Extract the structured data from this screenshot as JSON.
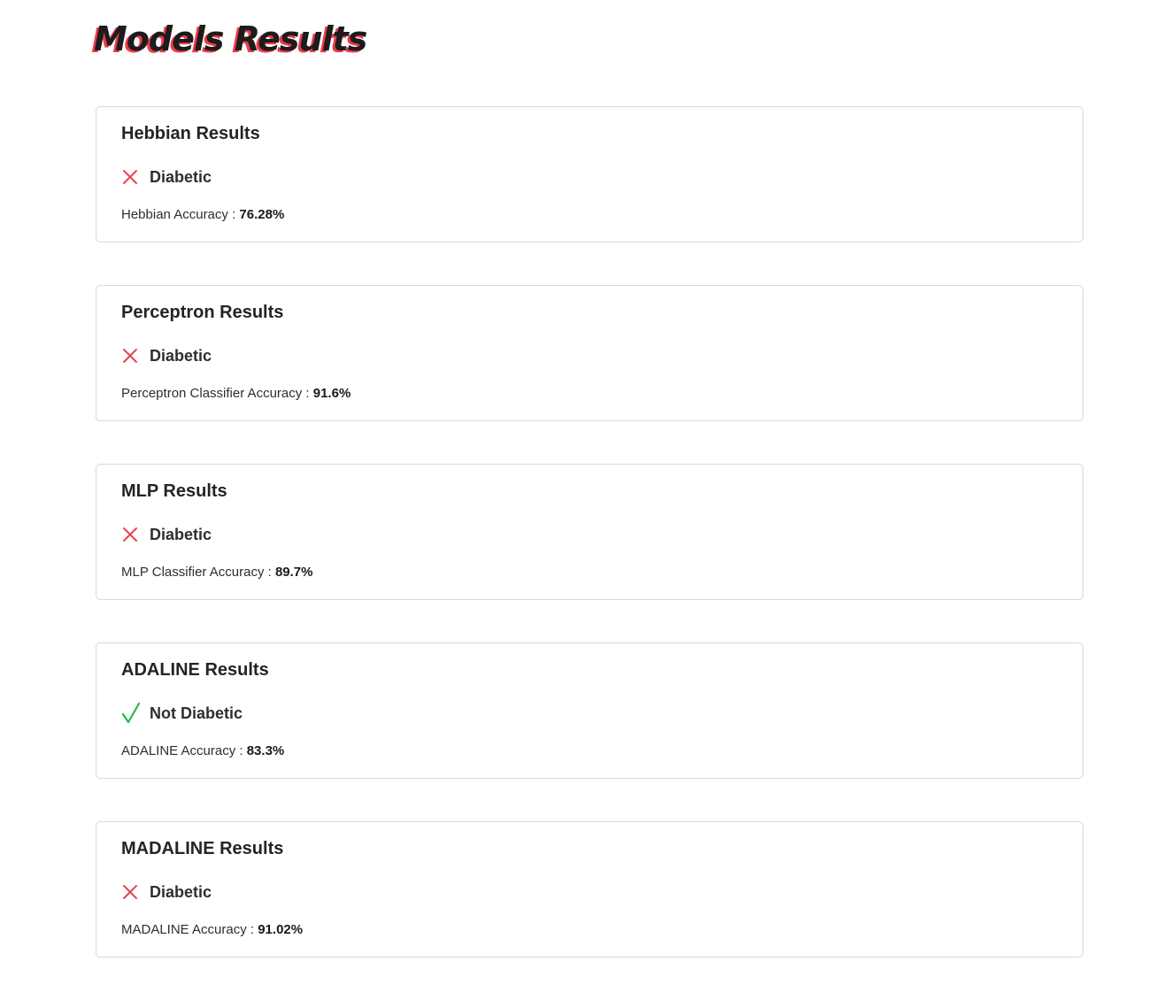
{
  "page": {
    "title": "Models Results"
  },
  "colors": {
    "negative_icon": "#e8424f",
    "positive_icon": "#2db83d",
    "title_shadow": "#ef3b4a"
  },
  "cards": [
    {
      "title": "Hebbian Results",
      "icon": "cross-icon",
      "verdict": "Diabetic",
      "accuracy_label": "Hebbian Accuracy : ",
      "accuracy_value": "76.28%"
    },
    {
      "title": "Perceptron Results",
      "icon": "cross-icon",
      "verdict": "Diabetic",
      "accuracy_label": "Perceptron Classifier Accuracy : ",
      "accuracy_value": "91.6%"
    },
    {
      "title": "MLP Results",
      "icon": "cross-icon",
      "verdict": "Diabetic",
      "accuracy_label": "MLP Classifier Accuracy : ",
      "accuracy_value": "89.7%"
    },
    {
      "title": "ADALINE Results",
      "icon": "check-icon",
      "verdict": "Not Diabetic",
      "accuracy_label": "ADALINE Accuracy : ",
      "accuracy_value": "83.3%"
    },
    {
      "title": "MADALINE Results",
      "icon": "cross-icon",
      "verdict": "Diabetic",
      "accuracy_label": "MADALINE Accuracy : ",
      "accuracy_value": "91.02%"
    }
  ]
}
